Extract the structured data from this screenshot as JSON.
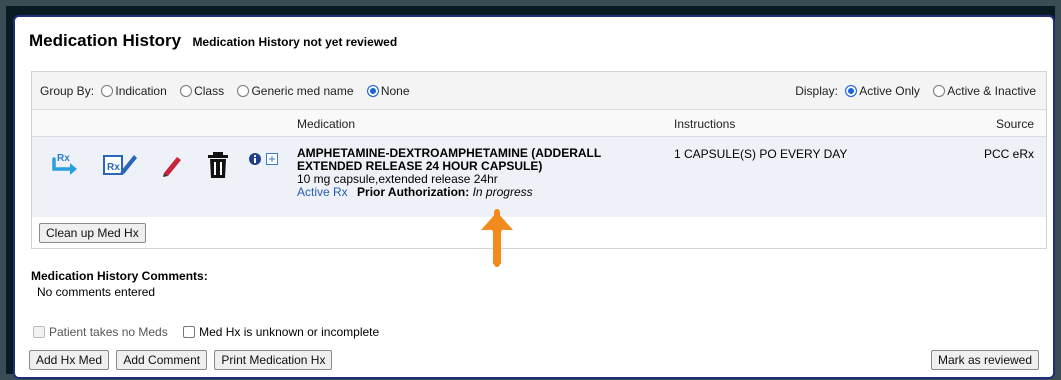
{
  "header": {
    "title": "Medication History",
    "subtitle": "Medication History not yet reviewed"
  },
  "group_by": {
    "label": "Group By:",
    "options": [
      "Indication",
      "Class",
      "Generic med name",
      "None"
    ],
    "selected": "None"
  },
  "display": {
    "label": "Display:",
    "options": [
      "Active Only",
      "Active & Inactive"
    ],
    "selected": "Active Only"
  },
  "columns": {
    "medication": "Medication",
    "instructions": "Instructions",
    "source": "Source"
  },
  "medications": [
    {
      "name_line1": "AMPHETAMINE-DEXTROAMPHETAMINE (ADDERALL",
      "name_line2": "EXTENDED RELEASE 24 HOUR CAPSULE)",
      "detail": "10 mg capsule,extended release 24hr",
      "status": "Active Rx",
      "pa_label": "Prior Authorization:",
      "pa_value": "In progress",
      "instructions": "1 CAPSULE(S) PO EVERY DAY",
      "source": "PCC eRx",
      "icons": [
        "rx-renew-icon",
        "rx-edit-icon",
        "pencil-icon",
        "trash-icon",
        "info-icon",
        "expand-icon"
      ]
    }
  ],
  "buttons": {
    "cleanup": "Clean up Med Hx",
    "add_hx_med": "Add Hx Med",
    "add_comment": "Add Comment",
    "print": "Print Medication Hx",
    "mark_reviewed": "Mark as reviewed"
  },
  "comments": {
    "heading": "Medication History Comments:",
    "body": "No comments entered"
  },
  "checkboxes": {
    "no_meds": "Patient takes no Meds",
    "unknown": "Med Hx is unknown or incomplete"
  },
  "colors": {
    "accent": "#1a63d6",
    "link": "#2a5db0",
    "arrow": "#f28a1e",
    "pencil": "#c8243a",
    "card_border": "#1f2f7a"
  }
}
